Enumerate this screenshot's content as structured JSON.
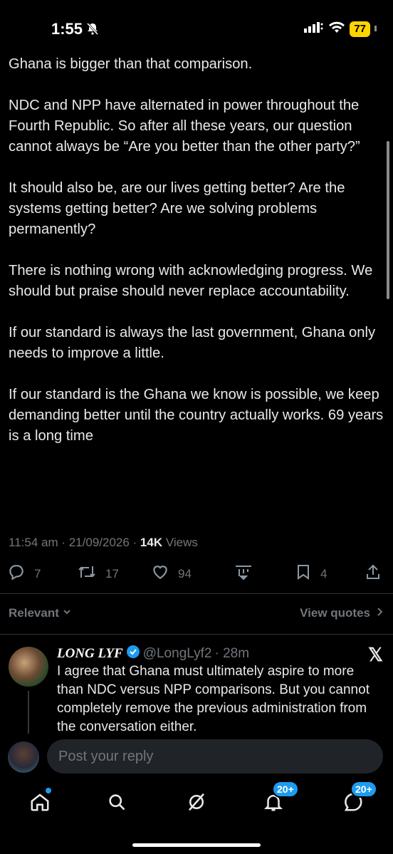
{
  "status": {
    "time": "1:55",
    "battery": "77"
  },
  "tweet": {
    "paragraphs": [
      "Ghana is bigger than that comparison.",
      "NDC and NPP have alternated in power throughout the Fourth Republic.  So after all these years, our question cannot always be “Are you better than the other party?”",
      "It should also be, are our lives getting better? Are the systems getting better? Are we solving problems permanently?",
      "There is nothing wrong with acknowledging progress. We should but praise should never replace accountability.",
      "If our standard is always the last government, Ghana only needs to improve a little.",
      "If our standard is the Ghana we know is possible, we keep demanding better until the country actually works. 69 years is a long time"
    ],
    "timestamp": "11:54 am · 21/09/2026 · ",
    "views_count": "14K",
    "views_label": " Views",
    "actions": {
      "replies": "7",
      "reposts": "17",
      "likes": "94",
      "bookmarks": "4"
    }
  },
  "filter": {
    "relevant_label": "Relevant",
    "view_quotes_label": "View quotes"
  },
  "reply": {
    "name": "LONG LYF",
    "handle": "@LongLyf2",
    "time": "· 28m",
    "text": "I agree that Ghana must ultimately aspire to more than NDC versus NPP comparisons. But you cannot completely remove the previous administration from the conversation either."
  },
  "compose": {
    "placeholder": "Post your reply"
  },
  "tabbar": {
    "notifications_badge": "20+",
    "messages_badge": "20+"
  },
  "colors": {
    "accent": "#1d9bf0",
    "muted": "#71767b",
    "battery": "#ffd400"
  }
}
